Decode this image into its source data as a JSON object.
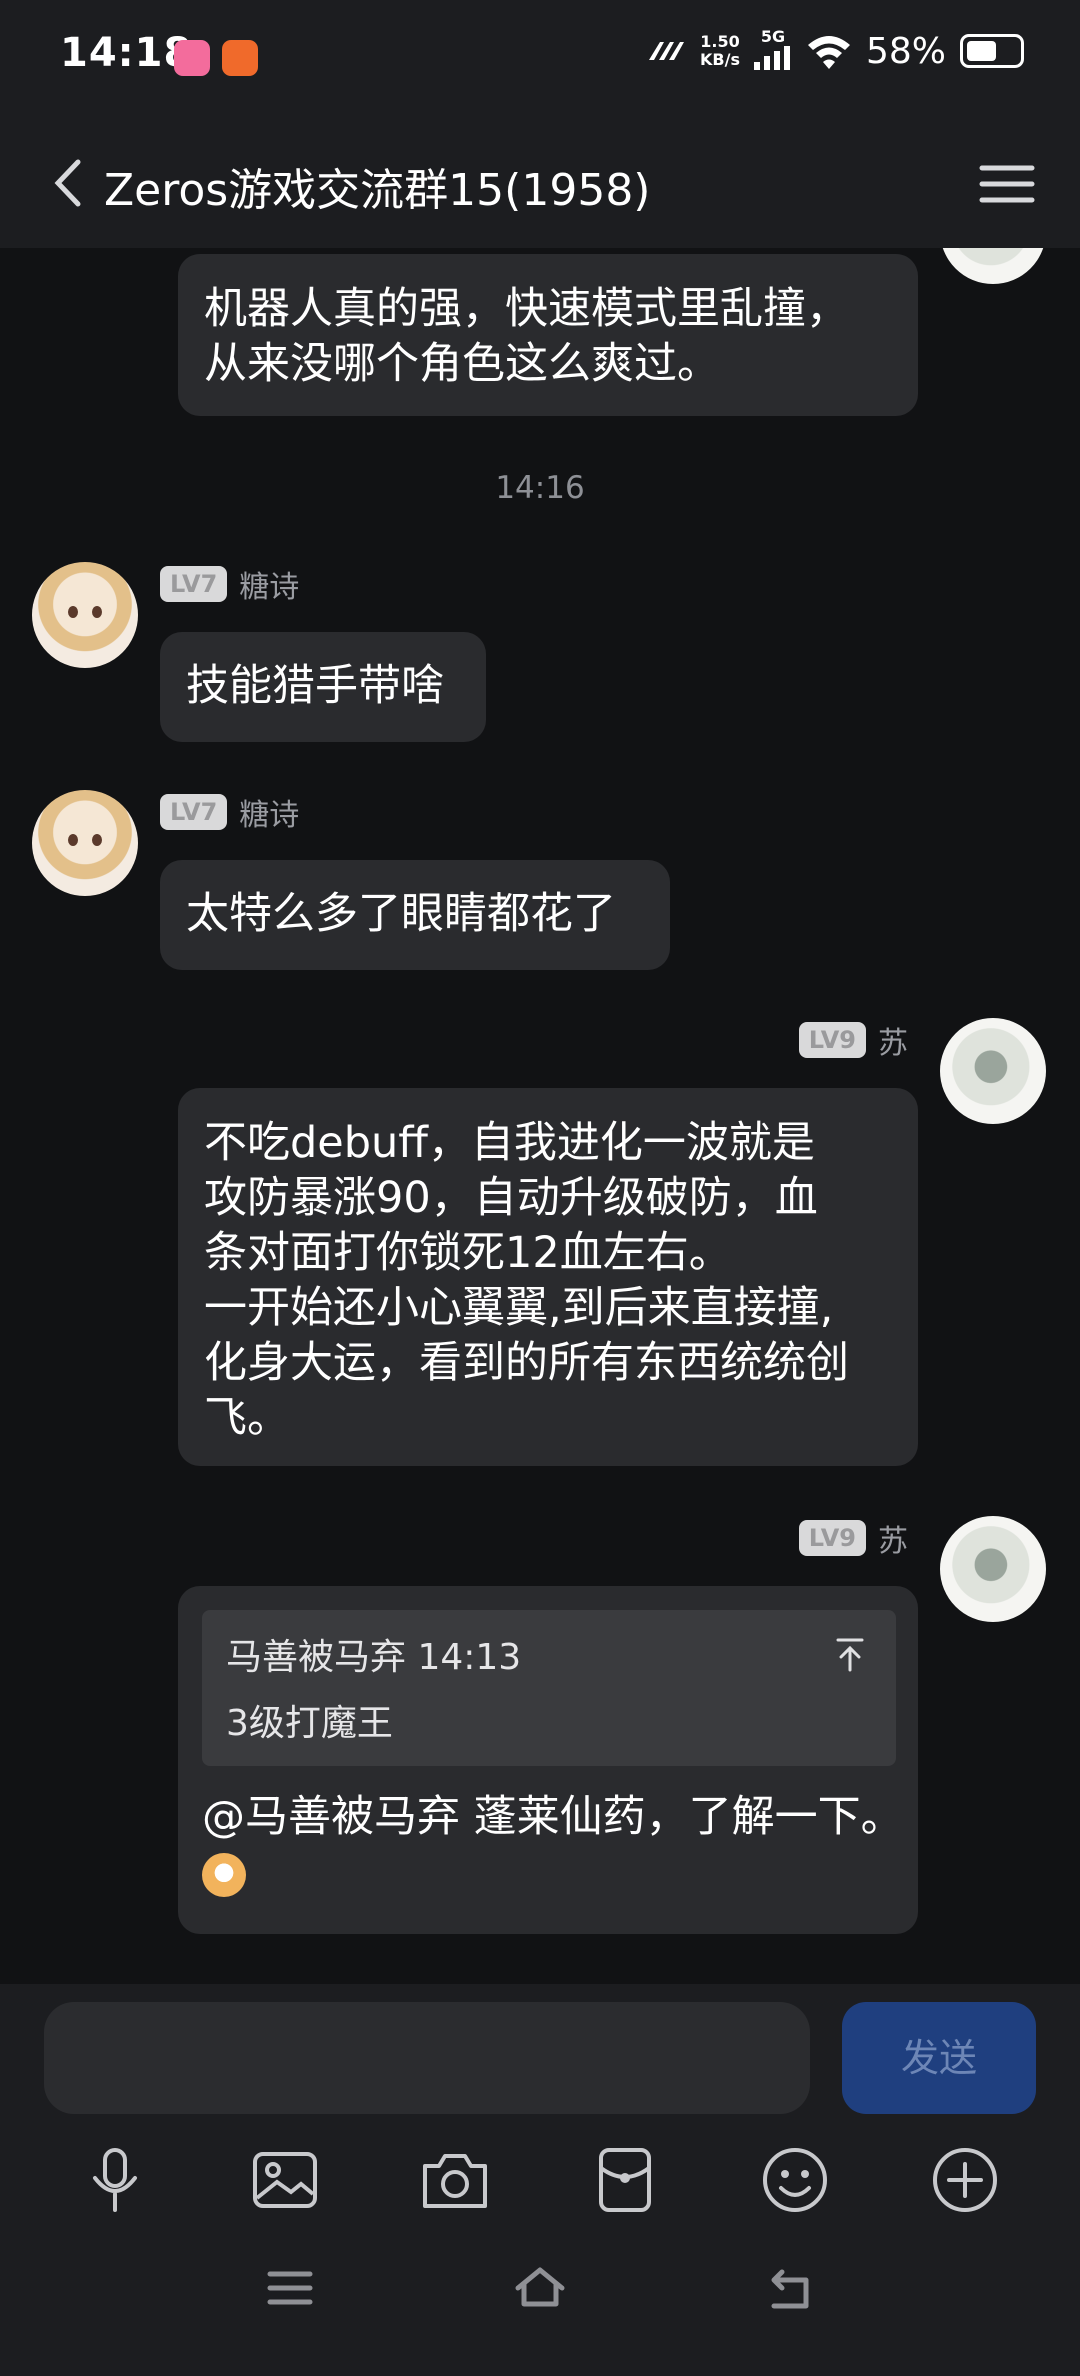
{
  "status_bar": {
    "time": "14:18",
    "network_speed_top": "1.50",
    "network_speed_bottom": "KB/s",
    "network_type": "5G",
    "battery": "58%",
    "battery_level": 0.58
  },
  "header": {
    "title": "Zeros游戏交流群15(1958)",
    "back_icon": "chevron-left-icon",
    "menu_icon": "hamburger-menu-icon"
  },
  "messages": [
    {
      "text": "机器人真的强，快速模式里乱撞，\n从来没哪个角色这么爽过。"
    },
    {
      "timestamp": "14:16"
    },
    {
      "level": "LV7",
      "name": "糖诗",
      "text": "技能猎手带啥"
    },
    {
      "level": "LV7",
      "name": "糖诗",
      "text": "太特么多了眼睛都花了"
    },
    {
      "level": "LV9",
      "name": "苏",
      "text": "不吃debuff，自我进化一波就是\n攻防暴涨90，自动升级破防，血\n条对面打你锁死12血左右。\n一开始还小心翼翼,到后来直接撞,\n化身大运，看到的所有东西统统创\n飞。"
    },
    {
      "level": "LV9",
      "name": "苏",
      "quote_meta": "马善被马弃 14:13",
      "quote_text": "3级打魔王",
      "text": "@马善被马弃 蓬莱仙药，了解一下。"
    }
  ],
  "input": {
    "placeholder": "",
    "send_label": "发送"
  },
  "toolbar": [
    "microphone-icon",
    "image-icon",
    "camera-icon",
    "red-packet-icon",
    "emoji-icon",
    "plus-icon"
  ],
  "navigation": [
    "menu-nav-icon",
    "home-nav-icon",
    "back-nav-icon"
  ]
}
